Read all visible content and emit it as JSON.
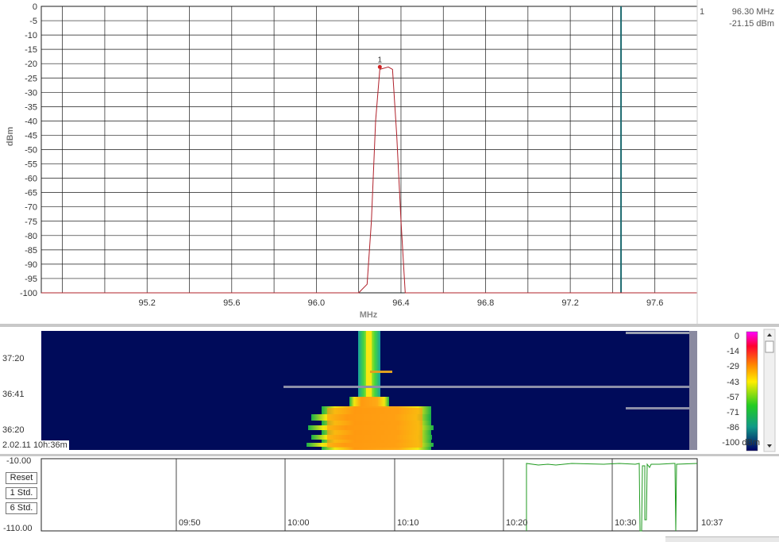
{
  "spectrum": {
    "ylabel": "dBm",
    "xlabel": "MHz",
    "marker_index": "1",
    "marker_freq": "96.30 MHz",
    "marker_level": "-21.15 dBm",
    "colors": {
      "trace": "#b0202a",
      "cursor": "#1d6a70",
      "grid": "#1a1a1a"
    }
  },
  "chart_data": {
    "type": "line",
    "xlabel": "MHz",
    "ylabel": "dBm",
    "xlim": [
      94.7,
      97.8
    ],
    "ylim": [
      -100,
      0
    ],
    "x_ticks": [
      "95.2",
      "95.6",
      "96.0",
      "96.4",
      "96.8",
      "97.2",
      "97.6"
    ],
    "y_ticks": [
      "0",
      "-5",
      "-10",
      "-15",
      "-20",
      "-25",
      "-30",
      "-35",
      "-40",
      "-45",
      "-50",
      "-55",
      "-60",
      "-65",
      "-70",
      "-75",
      "-80",
      "-85",
      "-90",
      "-95",
      "-100"
    ],
    "series": [
      {
        "x": [
          94.7,
          96.2,
          96.24,
          96.26,
          96.28,
          96.3,
          96.34,
          96.36,
          96.38,
          96.4,
          96.42,
          97.8
        ],
        "y": [
          -100,
          -100,
          -97,
          -75,
          -40,
          -22,
          -21.15,
          -22,
          -45,
          -75,
          -100,
          -100
        ]
      }
    ],
    "cursor_x": 97.44,
    "grid": true
  },
  "waterfall": {
    "time_labels": [
      "37:20",
      "36:41",
      "36:20"
    ],
    "timestamp": "2.02.11 10h:36m",
    "scale_labels": [
      "0",
      "-14",
      "-29",
      "-43",
      "-57",
      "-71",
      "-86",
      "-100 dBm"
    ]
  },
  "history": {
    "top_label": "-10.00",
    "bottom_label": "-110.00",
    "buttons": [
      "Reset",
      "1 Std.",
      "6 Std."
    ],
    "time_ticks": [
      "09:50",
      "10:00",
      "10:10",
      "10:20",
      "10:30",
      "10:37"
    ]
  }
}
